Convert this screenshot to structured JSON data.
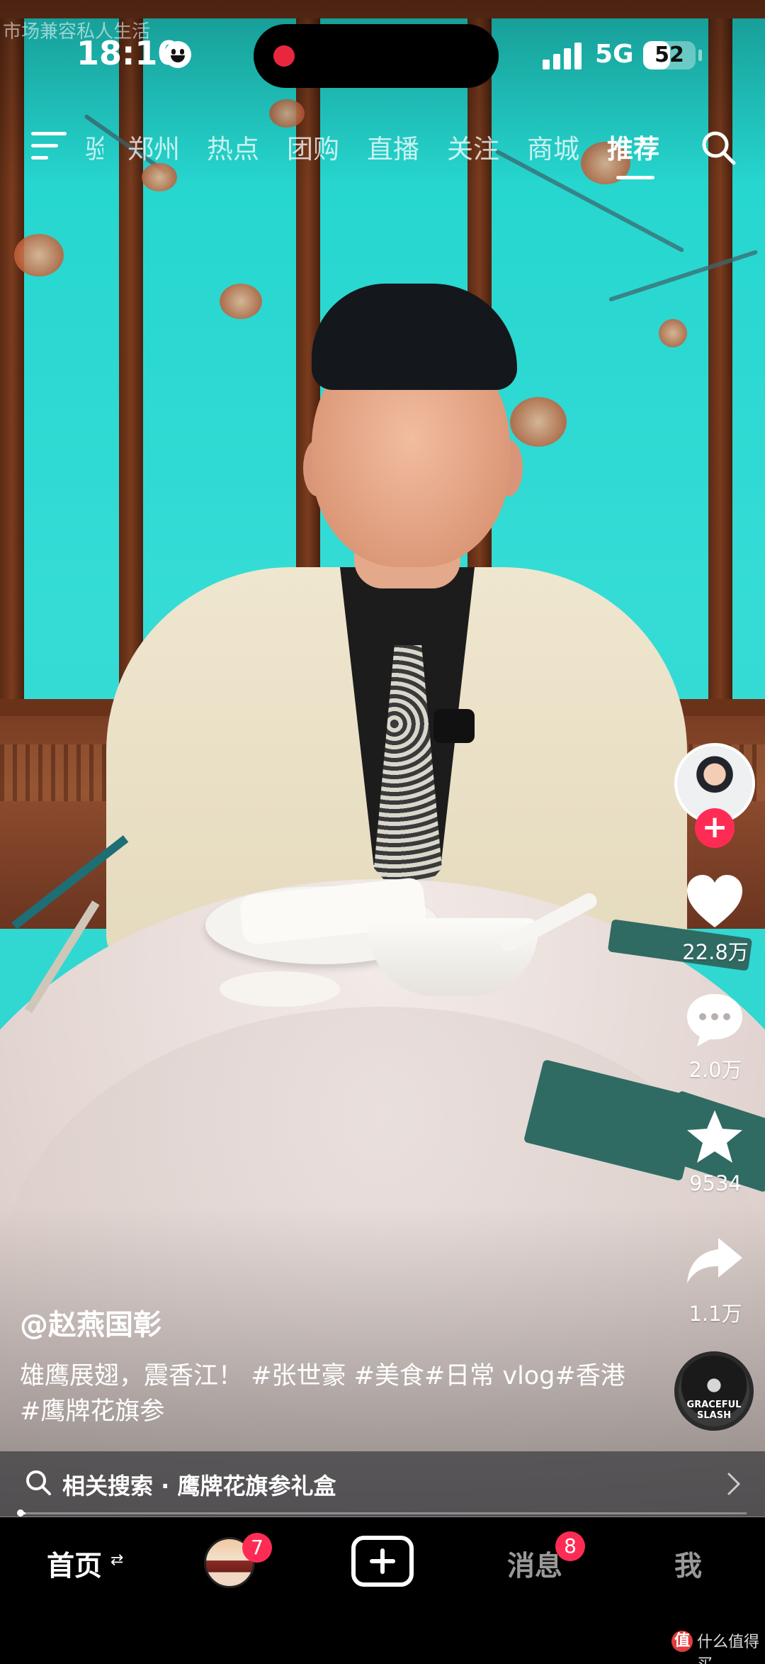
{
  "video": {
    "watermark": "市场兼容私人生活"
  },
  "status_bar": {
    "time": "18:10",
    "network": "5G",
    "battery": "52",
    "battery_level": 0.52
  },
  "top_nav": {
    "tabs": [
      {
        "label": "验",
        "active": false
      },
      {
        "label": "郑州",
        "active": false
      },
      {
        "label": "热点",
        "active": false
      },
      {
        "label": "团购",
        "active": false
      },
      {
        "label": "直播",
        "active": false
      },
      {
        "label": "关注",
        "active": false
      },
      {
        "label": "商城",
        "active": false
      },
      {
        "label": "推荐",
        "active": true
      }
    ],
    "icons": {
      "menu": "menu-icon",
      "search": "search-icon"
    }
  },
  "actions": {
    "follow": "+",
    "likes": "22.8万",
    "comments": "2.0万",
    "favorites": "9534",
    "shares": "1.1万",
    "music_disc_text": "GRACEFUL SLASH"
  },
  "post": {
    "author": "@赵燕国彰",
    "caption": "雄鹰展翅，震香江！ #张世豪 #美食#日常 vlog#香港#鹰牌花旗参"
  },
  "related_search": {
    "text": "相关搜索 · 鹰牌花旗参礼盒",
    "progress": 0.01
  },
  "bottom_nav": {
    "home": "首页",
    "home_swap": "⇄",
    "friends_badge": "7",
    "messages": "消息",
    "messages_badge": "8",
    "me": "我"
  },
  "footer_watermark": {
    "logo": "值",
    "text": "什么值得买"
  },
  "colors": {
    "accent": "#fe2c55",
    "video_bg": "#2ad3cc"
  }
}
